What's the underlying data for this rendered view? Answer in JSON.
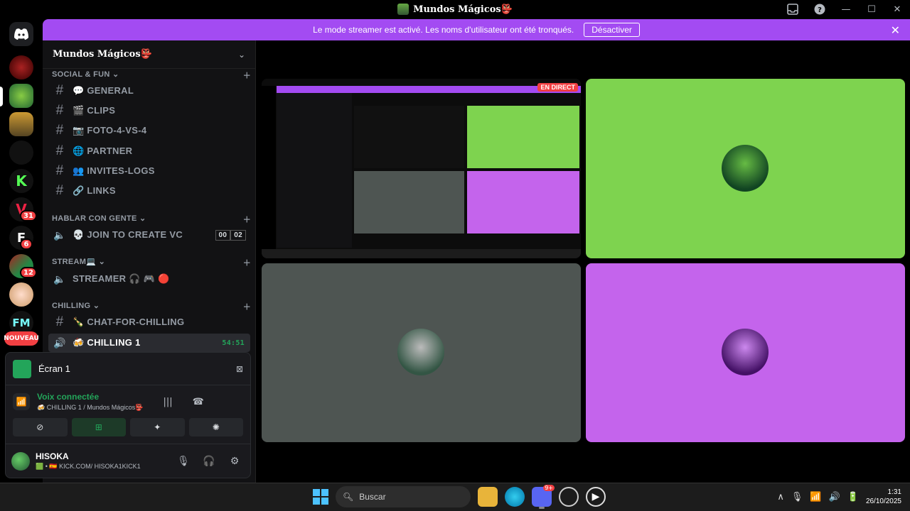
{
  "window": {
    "title": "Mundos Mágicos👺"
  },
  "banner": {
    "text": "Le mode streamer est activé. Les noms d'utilisateur ont été tronqués.",
    "button": "Désactiver"
  },
  "guilds": {
    "badges": [
      "31",
      "6",
      "12"
    ],
    "new_label": "NOUVEAU"
  },
  "server": {
    "name": "Mundos Mágicos👺"
  },
  "categories": [
    {
      "name": "SOCIAL & FUN ⌄"
    },
    {
      "name": "HABLAR CON GENTE ⌄"
    },
    {
      "name": "STREAM💻 ⌄"
    },
    {
      "name": "CHILLING ⌄"
    }
  ],
  "channels": {
    "social": [
      "💬 GENERAL",
      "🎬 CLIPS",
      "📷 FOTO-4-VS-4",
      "🌐 PARTNER",
      "👥 INVITES-LOGS",
      "🔗 LINKS"
    ],
    "voice_join": "💀 JOIN TO CREATE VC",
    "voice_join_count": [
      "00",
      "02"
    ],
    "streamer": "STREAMER 🎧 🎮 🔴",
    "chat_chilling": "🍾 CHAT-FOR-CHILLING",
    "chilling1": "🍻 CHILLING 1",
    "chilling1_timer": "54:51"
  },
  "panel": {
    "screen_label": "Écran 1",
    "voice_status": "Voix connectée",
    "voice_channel": "🍻 CHILLING 1 / Mundos Mágicos👺",
    "user_name": "HISOKA",
    "user_status": "🟩 • 🇪🇸 KICK.COM/ HISOKA1KICK1"
  },
  "stage": {
    "live_label": "EN DIRECT",
    "tile_colors": [
      "#7ed34f",
      "#4e5552",
      "#c464ec"
    ]
  },
  "taskbar": {
    "search_placeholder": "Buscar",
    "discord_badge": "9+",
    "time": "1:31",
    "date": "26/10/2025"
  }
}
